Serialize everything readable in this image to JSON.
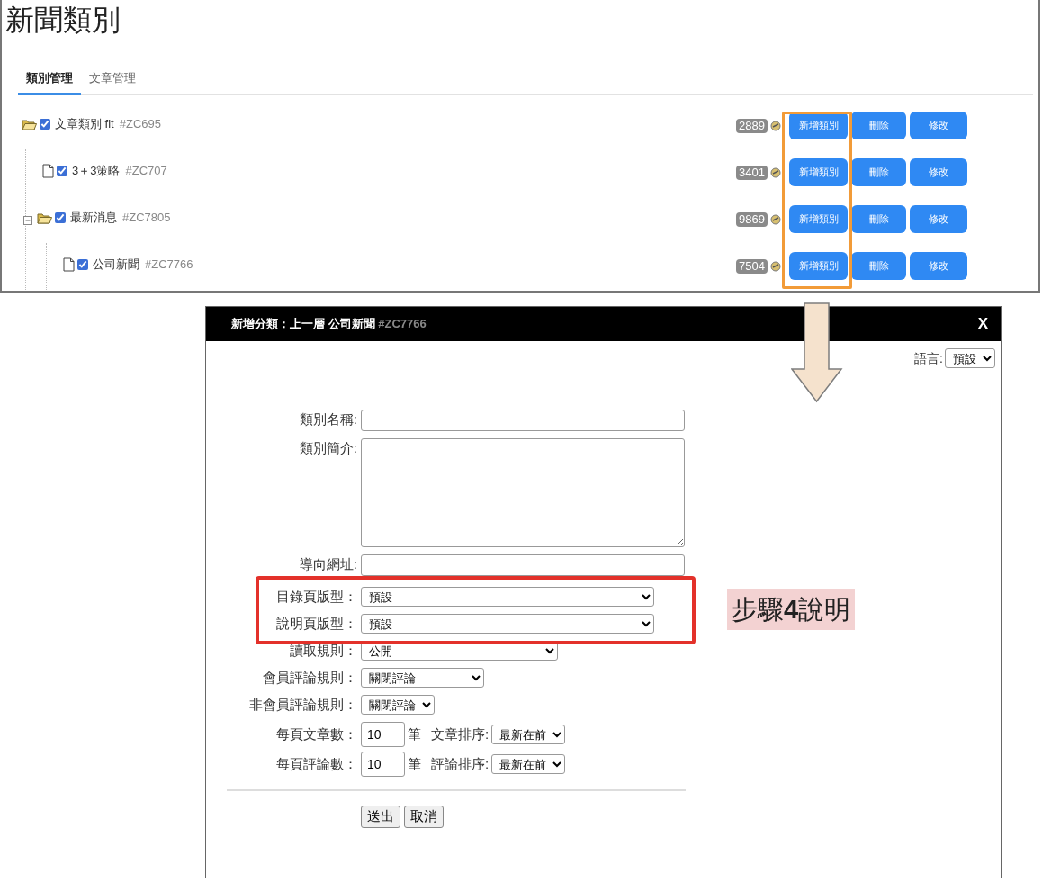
{
  "page_title": "新聞類別",
  "tabs": [
    {
      "label": "類別管理",
      "selected": true
    },
    {
      "label": "文章管理",
      "selected": false
    }
  ],
  "tree": [
    {
      "kind": "folder",
      "label": "文章類別 fit",
      "code": "#ZC695",
      "checked": true,
      "count": "2889",
      "actions": [
        "新增類別",
        "刪除",
        "修改"
      ],
      "children": [
        {
          "kind": "file",
          "label": "3＋3策略",
          "code": "#ZC707",
          "checked": true,
          "count": "3401",
          "actions": [
            "新增類別",
            "刪除",
            "修改"
          ]
        },
        {
          "kind": "folder",
          "label": "最新消息",
          "code": "#ZC7805",
          "checked": true,
          "expanded": true,
          "count": "9869",
          "actions": [
            "新增類別",
            "刪除",
            "修改"
          ],
          "children": [
            {
              "kind": "file",
              "label": "公司新聞",
              "code": "#ZC7766",
              "checked": true,
              "count": "7504",
              "actions": [
                "新增類別",
                "刪除",
                "修改"
              ]
            }
          ]
        }
      ]
    }
  ],
  "dialog": {
    "title": "新增分類：上一層 公司新聞",
    "title_code": "#ZC7766",
    "close": "X",
    "language_label": "語言:",
    "language_value": "預設",
    "fields": [
      {
        "kind": "text",
        "label": "類別名稱:"
      },
      {
        "kind": "textarea",
        "label": "類別簡介:"
      },
      {
        "kind": "text",
        "label": "導向網址:"
      },
      {
        "kind": "select",
        "label": "目錄頁版型：",
        "value": "預設"
      },
      {
        "kind": "select",
        "label": "說明頁版型：",
        "value": "預設"
      },
      {
        "kind": "select",
        "label": "讀取規則：",
        "value": "公開"
      },
      {
        "kind": "select",
        "label": "會員評論規則：",
        "value": "關閉評論"
      },
      {
        "kind": "select",
        "label": "非會員評論規則：",
        "value": "關閉評論"
      },
      {
        "kind": "count",
        "label": "每頁文章數：",
        "value": "10",
        "unit": "筆",
        "sort_label": "文章排序:",
        "sort_value": "最新在前"
      },
      {
        "kind": "count",
        "label": "每頁評論數：",
        "value": "10",
        "unit": "筆",
        "sort_label": "評論排序:",
        "sort_value": "最新在前"
      }
    ],
    "buttons": [
      "送出",
      "取消"
    ]
  },
  "callout": "步驟**4**說明"
}
